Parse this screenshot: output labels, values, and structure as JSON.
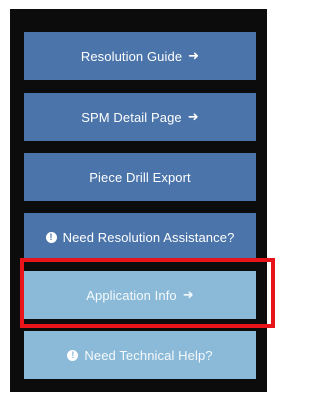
{
  "menu": {
    "items": [
      {
        "label": "Resolution Guide",
        "arrow": "➜"
      },
      {
        "label": "SPM Detail Page",
        "arrow": "➜"
      },
      {
        "label": "Piece Drill Export"
      },
      {
        "label": "Need Resolution Assistance?",
        "icon": "info-icon"
      },
      {
        "label": "Application Info",
        "arrow": "➜"
      },
      {
        "label": "Need Technical Help?",
        "icon": "info-icon"
      }
    ]
  },
  "info_glyph": "!",
  "colors": {
    "dark_button": "#4a74aa",
    "light_button": "#8bbad8",
    "highlight": "#e8141a",
    "frame": "#0c0c0c"
  }
}
